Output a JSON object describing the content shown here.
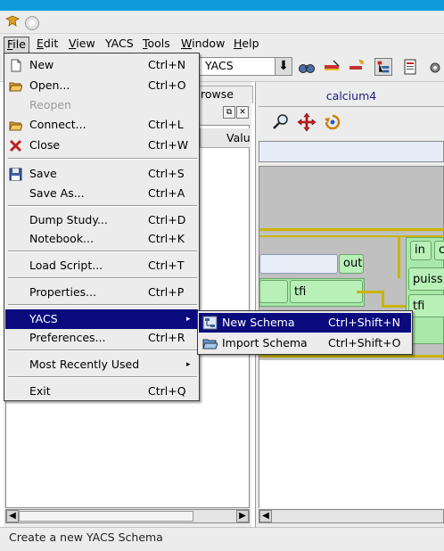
{
  "menubar": {
    "items": [
      {
        "label": "File",
        "mnemonic": "F",
        "rest": "ile"
      },
      {
        "label": "Edit",
        "mnemonic": "E",
        "rest": "dit"
      },
      {
        "label": "View",
        "mnemonic": "V",
        "rest": "iew"
      },
      {
        "label": "YACS",
        "mnemonic": "",
        "rest": "YACS"
      },
      {
        "label": "Tools",
        "mnemonic": "T",
        "rest": "ools"
      },
      {
        "label": "Window",
        "mnemonic": "W",
        "rest": "indow"
      },
      {
        "label": "Help",
        "mnemonic": "H",
        "rest": "elp"
      }
    ]
  },
  "toolbar": {
    "module_selector": "YACS",
    "combo_arrow": "⬇"
  },
  "left_dock": {
    "tab_label": "rowse",
    "column_header": "Valu",
    "dock_buttons": [
      "⧉",
      "✕"
    ]
  },
  "right_panel": {
    "tab_title": "calcium4"
  },
  "schema": {
    "ports": [
      "out",
      "tfi",
      "in",
      "c",
      "puiss",
      "tfi"
    ]
  },
  "file_menu": {
    "items": [
      {
        "label": "New",
        "shortcut": "Ctrl+N",
        "icon": "new-document-icon"
      },
      {
        "label": "Open...",
        "shortcut": "Ctrl+O",
        "icon": "folder-open-icon"
      },
      {
        "label": "Reopen",
        "shortcut": "",
        "icon": "",
        "disabled": true
      },
      {
        "label": "Connect...",
        "shortcut": "Ctrl+L",
        "icon": "connect-folder-icon"
      },
      {
        "label": "Close",
        "shortcut": "Ctrl+W",
        "icon": "close-x-icon"
      },
      {
        "label": "Save",
        "shortcut": "Ctrl+S",
        "icon": "floppy-icon"
      },
      {
        "label": "Save As...",
        "shortcut": "Ctrl+A",
        "icon": ""
      },
      {
        "label": "Dump Study...",
        "shortcut": "Ctrl+D",
        "icon": ""
      },
      {
        "label": "Notebook...",
        "shortcut": "Ctrl+K",
        "icon": ""
      },
      {
        "label": "Load Script...",
        "shortcut": "Ctrl+T",
        "icon": ""
      },
      {
        "label": "Properties...",
        "shortcut": "Ctrl+P",
        "icon": ""
      },
      {
        "label": "YACS",
        "shortcut": "",
        "icon": "",
        "submenu": true,
        "highlighted": true
      },
      {
        "label": "Preferences...",
        "shortcut": "Ctrl+R",
        "icon": ""
      },
      {
        "label": "Most Recently Used",
        "shortcut": "",
        "icon": "",
        "submenu": true
      },
      {
        "label": "Exit",
        "shortcut": "Ctrl+Q",
        "icon": ""
      }
    ],
    "submenu_arrow": "▸"
  },
  "yacs_submenu": {
    "items": [
      {
        "label": "New Schema",
        "shortcut": "Ctrl+Shift+N",
        "icon": "new-schema-icon",
        "highlighted": true
      },
      {
        "label": "Import Schema",
        "shortcut": "Ctrl+Shift+O",
        "icon": "import-schema-icon"
      }
    ]
  },
  "statusbar": {
    "text": "Create a new YACS Schema"
  },
  "colors": {
    "menu_highlight": "#0b0b7e",
    "node_green": "#a8e8a8",
    "link_yellow": "#c8b400",
    "canvas_gray": "#c0c0c0"
  }
}
